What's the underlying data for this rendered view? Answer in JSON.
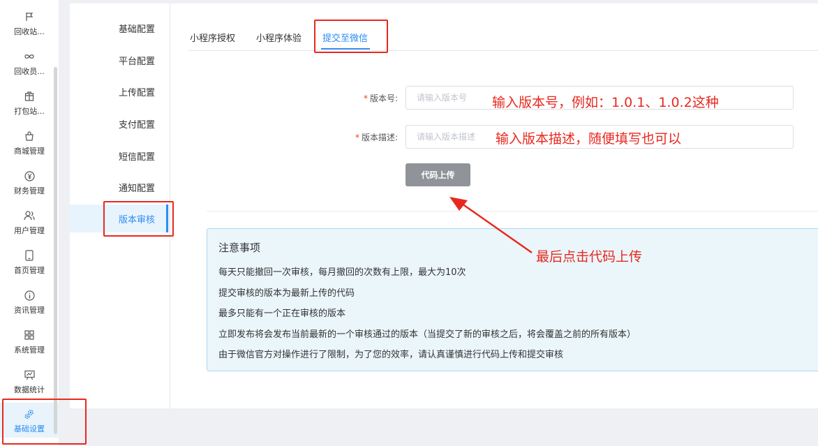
{
  "sidebar": {
    "items": [
      {
        "label": "回收站...",
        "icon": "flag-icon"
      },
      {
        "label": "回收员...",
        "icon": "infinity-icon"
      },
      {
        "label": "打包站...",
        "icon": "package-icon"
      },
      {
        "label": "商城管理",
        "icon": "shopping-bag-icon"
      },
      {
        "label": "财务管理",
        "icon": "yen-icon"
      },
      {
        "label": "用户管理",
        "icon": "users-icon"
      },
      {
        "label": "首页管理",
        "icon": "mobile-icon"
      },
      {
        "label": "资讯管理",
        "icon": "info-icon"
      },
      {
        "label": "系统管理",
        "icon": "grid-icon"
      },
      {
        "label": "数据统计",
        "icon": "chart-board-icon"
      },
      {
        "label": "基础设置",
        "icon": "gears-icon",
        "active": true
      }
    ]
  },
  "submenu": {
    "items": [
      {
        "label": "基础配置"
      },
      {
        "label": "平台配置"
      },
      {
        "label": "上传配置"
      },
      {
        "label": "支付配置"
      },
      {
        "label": "短信配置"
      },
      {
        "label": "通知配置"
      },
      {
        "label": "版本审核",
        "active": true
      }
    ]
  },
  "tabs": {
    "items": [
      {
        "label": "小程序授权"
      },
      {
        "label": "小程序体验"
      },
      {
        "label": "提交至微信",
        "active": true
      }
    ]
  },
  "form": {
    "version_label": "版本号:",
    "version_placeholder": "请输入版本号",
    "desc_label": "版本描述:",
    "desc_placeholder": "请输入版本描述",
    "required_mark": "*",
    "upload_button": "代码上传"
  },
  "notice": {
    "title": "注意事项",
    "lines": [
      "每天只能撤回一次审核，每月撤回的次数有上限，最大为10次",
      "提交审核的版本为最新上传的代码",
      "最多只能有一个正在审核的版本",
      "立即发布将会发布当前最新的一个审核通过的版本（当提交了新的审核之后，将会覆盖之前的所有版本）",
      "由于微信官方对操作进行了限制，为了您的效率，请认真谨慎进行代码上传和提交审核"
    ]
  },
  "annotations": {
    "version_hint": "输入版本号，例如：1.0.1、1.0.2这种",
    "desc_hint": "输入版本描述，随便填写也可以",
    "upload_hint": "最后点击代码上传"
  },
  "colors": {
    "accent": "#2d8cf0",
    "annotation_red": "#e8281f",
    "button_gray": "#909399",
    "notice_bg": "#ebf6fb"
  }
}
